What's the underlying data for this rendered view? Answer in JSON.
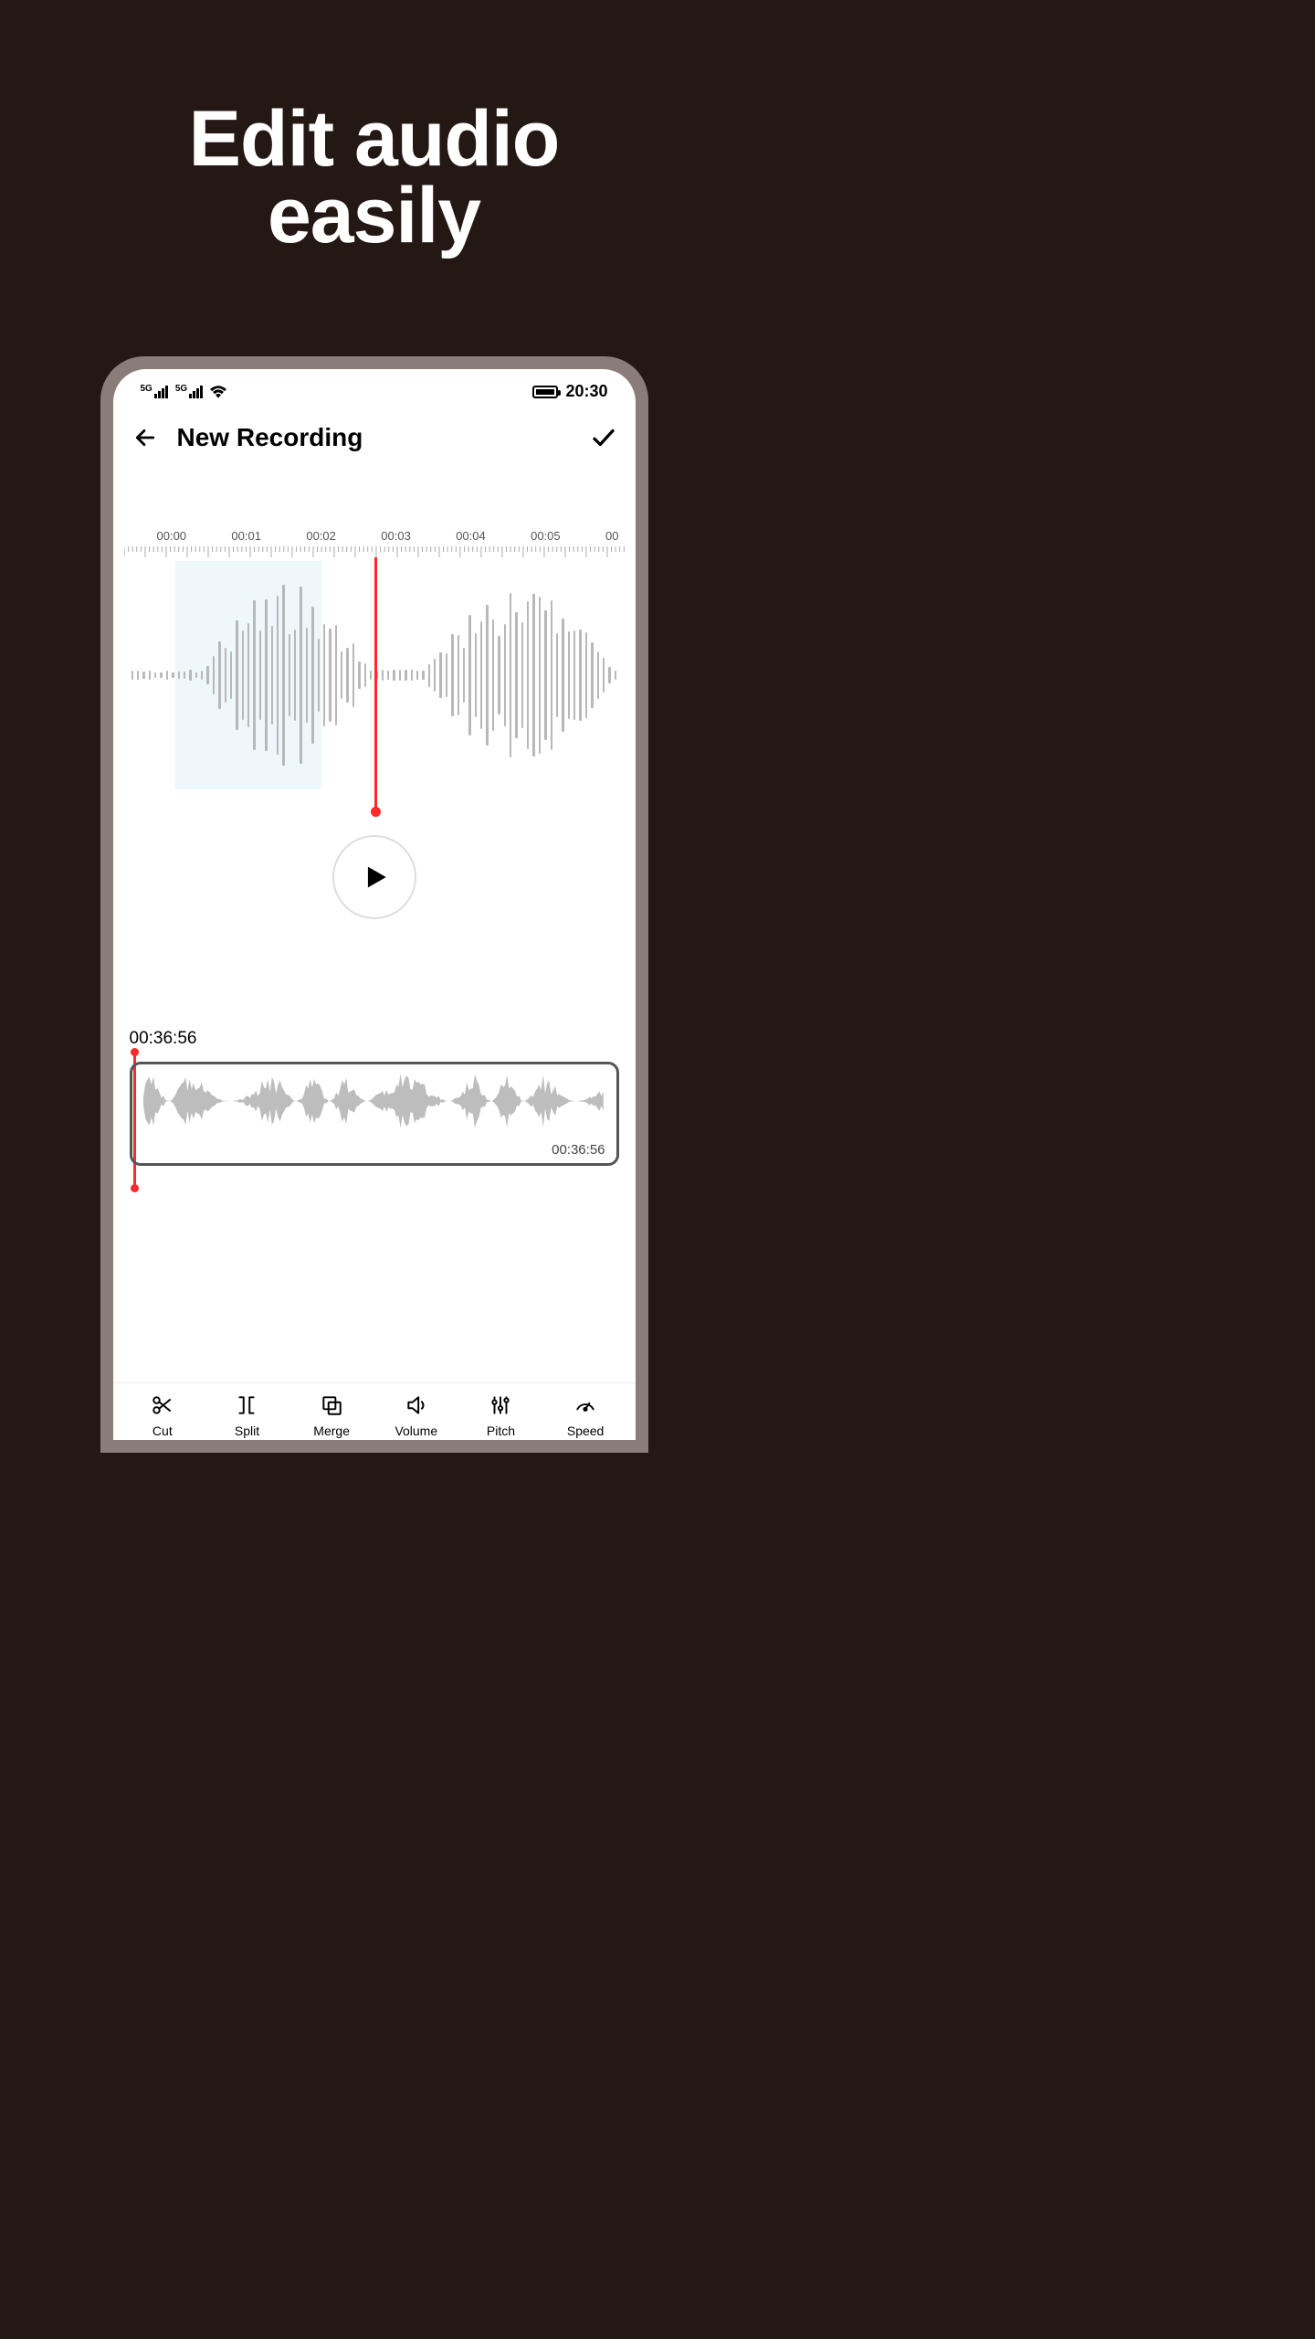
{
  "headline": {
    "line1": "Edit audio",
    "line2": "easily"
  },
  "status": {
    "clock": "20:30",
    "network_label": "5G"
  },
  "header": {
    "title": "New Recording"
  },
  "timeline": {
    "labels": [
      "00:00",
      "00:01",
      "00:02",
      "00:03",
      "00:04",
      "00:05",
      "00"
    ]
  },
  "mini": {
    "position_time": "00:36:56",
    "duration": "00:36:56"
  },
  "toolbar": {
    "items": [
      {
        "label": "Cut"
      },
      {
        "label": "Split"
      },
      {
        "label": "Merge"
      },
      {
        "label": "Volume"
      },
      {
        "label": "Pitch"
      },
      {
        "label": "Speed"
      }
    ]
  },
  "colors": {
    "accent": "#ff2a2a",
    "bg": "#241815"
  }
}
